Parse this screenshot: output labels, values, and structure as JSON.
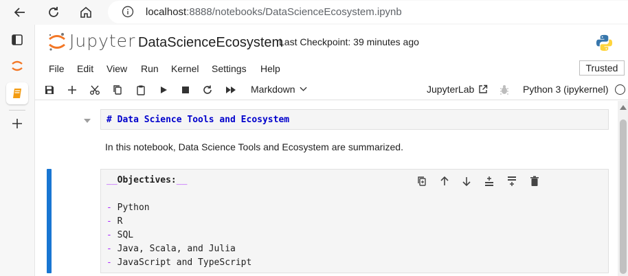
{
  "browser": {
    "url_host": "localhost",
    "url_rest": ":8888/notebooks/DataScienceEcosystem.ipynb",
    "back_icon": "arrow-left-icon",
    "reload_icon": "reload-icon",
    "home_icon": "home-icon",
    "info_icon": "info-icon"
  },
  "edge_sidebar": {
    "items": [
      {
        "icon": "tabs-icon"
      },
      {
        "icon": "jupyter-icon"
      },
      {
        "icon": "notebook-icon"
      },
      {
        "icon": "plus-icon"
      }
    ]
  },
  "header": {
    "logo_text": "Jupyter",
    "notebook_title": "DataScienceEcosystem",
    "checkpoint": "Last Checkpoint: 39 minutes ago"
  },
  "menu": {
    "items": [
      "File",
      "Edit",
      "View",
      "Run",
      "Kernel",
      "Settings",
      "Help"
    ],
    "trusted": "Trusted"
  },
  "toolbar": {
    "cell_type": "Markdown",
    "jupyterlab_label": "JupyterLab",
    "kernel_name": "Python 3 (ipykernel)"
  },
  "cells": {
    "cell1_source": "# Data Science Tools and Ecosystem",
    "rendered_text": "In this notebook, Data Science Tools and Ecosystem are summarized.",
    "cell2_heading": "Objectives:",
    "cell2_heading_marker": "__",
    "cell2_items": [
      "Python",
      "R",
      "SQL",
      "Java, Scala, and Julia",
      "JavaScript and TypeScript"
    ],
    "bullet": "-"
  },
  "colors": {
    "accent": "#1976d2",
    "markdown_heading": "#0000cc",
    "markdown_marker": "#aa22ff",
    "jupyter_orange": "#f37726"
  }
}
